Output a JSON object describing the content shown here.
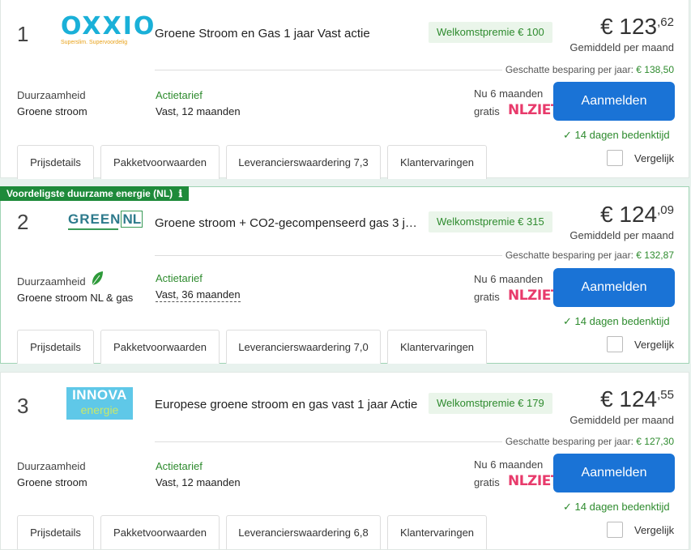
{
  "offers": [
    {
      "rank": "1",
      "logo_text": "OXXIO",
      "logo_tagline": "Superslim. Supervoordelig",
      "title": "Groene Stroom en Gas 1 jaar Vast actie",
      "promo": "Welkomstpremie € 100",
      "price_main": "€ 123",
      "price_cents": ",62",
      "price_sub": "Gemiddeld per maand",
      "saving_label": "Geschatte besparing per jaar:",
      "saving_value": "€ 138,50",
      "sustain_label": "Duurzaamheid",
      "sustain_value": "Groene stroom",
      "tariff_label": "Actietarief",
      "tariff_value": "Vast, 12 maanden",
      "bonus_line1": "Nu 6 maanden",
      "bonus_line2": "gratis",
      "bonus_brand": "NLZIET",
      "signup": "Aanmelden",
      "cooling": "14 dagen bedenktijd",
      "tabs": [
        "Prijsdetails",
        "Pakketvoorwaarden",
        "Leveranciersw aardering 7,3",
        "Klantervaringen"
      ],
      "compare": "Vergelijk"
    },
    {
      "rank": "2",
      "logo_text": "GREEN",
      "logo_text2": "NL",
      "title": "Groene stroom + CO2-gecompenseerd gas 3 ja…",
      "promo": "Welkomstpremie € 315",
      "price_main": "€ 124",
      "price_cents": ",09",
      "price_sub": "Gemiddeld per maand",
      "saving_label": "Geschatte besparing per jaar:",
      "saving_value": "€ 132,87",
      "sustain_label": "Duurzaamheid",
      "sustain_value": "Groene stroom NL & gas",
      "tariff_label": "Actietarief",
      "tariff_value": "Vast, 36 maanden",
      "bonus_line1": "Nu 6 maanden",
      "bonus_line2": "gratis",
      "bonus_brand": "NLZIET",
      "signup": "Aanmelden",
      "cooling": "14 dagen bedenktijd",
      "tabs": [
        "Prijsdetails",
        "Pakketvoorwaarden",
        "Leveranciersw aardering 7,0",
        "Klantervaringen"
      ],
      "compare": "Vergelijk"
    },
    {
      "rank": "3",
      "logo_text": "INNOVA",
      "logo_text2": "energie",
      "title": "Europese groene stroom en gas vast 1 jaar Actie",
      "promo": "Welkomstpremie € 179",
      "price_main": "€ 124",
      "price_cents": ",55",
      "price_sub": "Gemiddeld per maand",
      "saving_label": "Geschatte besparing per jaar:",
      "saving_value": "€ 127,30",
      "sustain_label": "Duurzaamheid",
      "sustain_value": "Groene stroom",
      "tariff_label": "Actietarief",
      "tariff_value": "Vast, 12 maanden",
      "bonus_line1": "Nu 6 maanden",
      "bonus_line2": "gratis",
      "bonus_brand": "NLZIET",
      "signup": "Aanmelden",
      "cooling": "14 dagen bedenktijd",
      "tabs": [
        "Prijsdetails",
        "Pakketvoorwaarden",
        "Leveranciersw aardering 6,8",
        "Klantervaringen"
      ],
      "compare": "Vergelijk"
    }
  ],
  "banner": "Voordeligste duurzame energie (NL)",
  "colors": {
    "primary_button": "#1a73d6",
    "accent_green": "#2e8b2e",
    "banner_green": "#1e8a3a",
    "nlziet_pink": "#e83a6b"
  }
}
